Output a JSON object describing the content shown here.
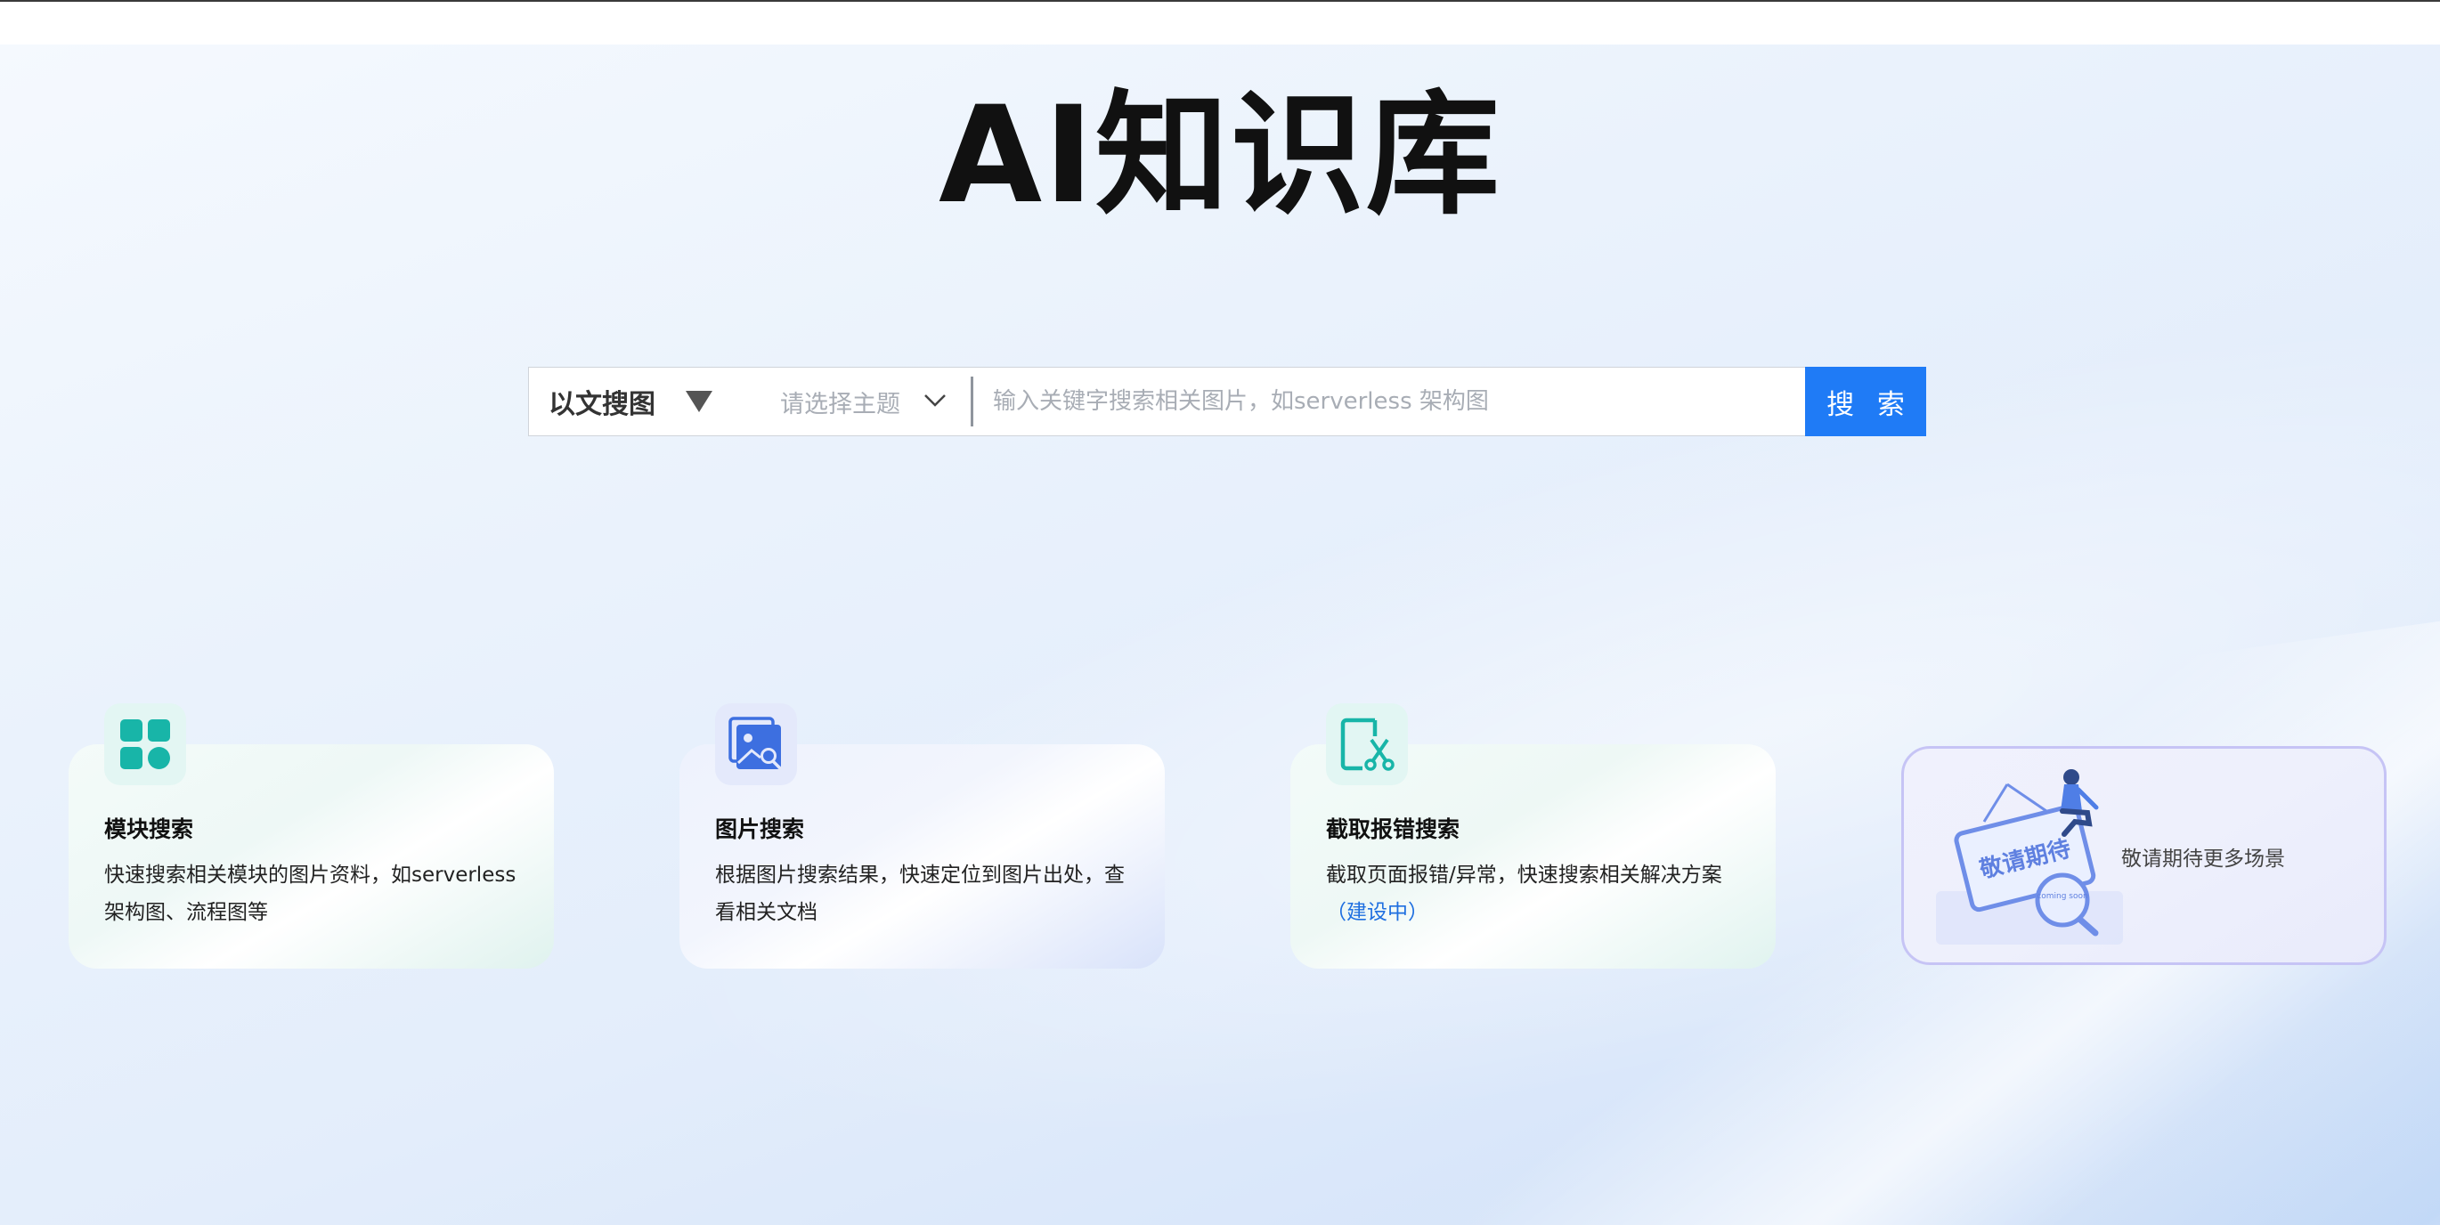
{
  "page": {
    "title": "AI知识库"
  },
  "search": {
    "mode_label": "以文搜图",
    "topic_placeholder": "请选择主题",
    "keyword_placeholder": "输入关键字搜索相关图片，如serverless 架构图",
    "button_label": "搜 索"
  },
  "cards": [
    {
      "icon": "grid-blocks-icon",
      "title": "模块搜索",
      "description": "快速搜索相关模块的图片资料，如serverless架构图、流程图等"
    },
    {
      "icon": "image-search-icon",
      "title": "图片搜索",
      "description": "根据图片搜索结果，快速定位到图片出处，查看相关文档"
    },
    {
      "icon": "screenshot-error-icon",
      "title": "截取报错搜索",
      "description": "截取页面报错/异常，快速搜索相关解决方案",
      "status": "（建设中）"
    }
  ],
  "coming_soon": {
    "illustration_sign_text": "敬请期待",
    "illustration_badge_text": "coming soon",
    "text": "敬请期待更多场景"
  },
  "colors": {
    "primary": "#1f7bf6",
    "teal_icon": "#18b5a8",
    "blue_icon": "#3d6fe0",
    "status_link": "#1f6fe0",
    "coming_border": "#c6c4f5"
  }
}
